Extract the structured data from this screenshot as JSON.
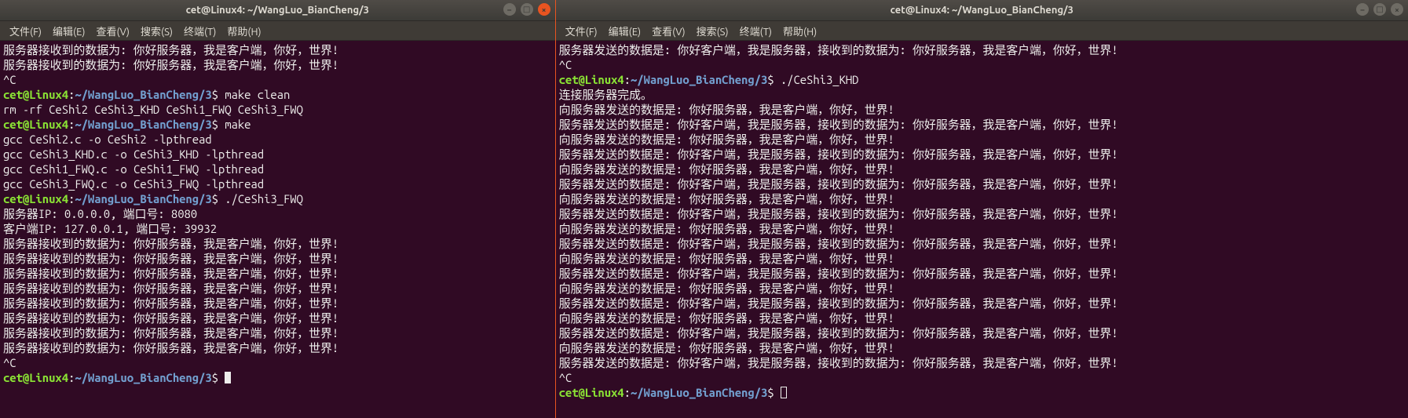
{
  "left": {
    "title": "cet@Linux4: ~/WangLuo_BianCheng/3",
    "menus": [
      "文件(F)",
      "编辑(E)",
      "查看(V)",
      "搜索(S)",
      "终端(T)",
      "帮助(H)"
    ],
    "window_controls": {
      "min": "–",
      "max": "□",
      "close": "×"
    },
    "prompt_user": "cet@Linux4",
    "prompt_colon": ":",
    "prompt_path": "~/WangLuo_BianCheng/3",
    "prompt_dollar": "$",
    "lines": [
      {
        "t": "out",
        "text": "服务器接收到的数据为: 你好服务器，我是客户端，你好，世界!"
      },
      {
        "t": "out",
        "text": "服务器接收到的数据为: 你好服务器，我是客户端，你好，世界!"
      },
      {
        "t": "out",
        "text": "^C"
      },
      {
        "t": "prompt",
        "cmd": "make clean"
      },
      {
        "t": "out",
        "text": "rm -rf CeShi2 CeShi3_KHD CeShi1_FWQ CeShi3_FWQ"
      },
      {
        "t": "prompt",
        "cmd": "make"
      },
      {
        "t": "out",
        "text": "gcc CeShi2.c -o CeShi2 -lpthread"
      },
      {
        "t": "out",
        "text": "gcc CeShi3_KHD.c -o CeShi3_KHD -lpthread"
      },
      {
        "t": "out",
        "text": "gcc CeShi1_FWQ.c -o CeShi1_FWQ -lpthread"
      },
      {
        "t": "out",
        "text": "gcc CeShi3_FWQ.c -o CeShi3_FWQ -lpthread"
      },
      {
        "t": "prompt",
        "cmd": "./CeShi3_FWQ"
      },
      {
        "t": "out",
        "text": "服务器IP: 0.0.0.0, 端口号: 8080"
      },
      {
        "t": "out",
        "text": "客户端IP: 127.0.0.1, 端口号: 39932"
      },
      {
        "t": "out",
        "text": "服务器接收到的数据为: 你好服务器，我是客户端，你好，世界!"
      },
      {
        "t": "out",
        "text": "服务器接收到的数据为: 你好服务器，我是客户端，你好，世界!"
      },
      {
        "t": "out",
        "text": "服务器接收到的数据为: 你好服务器，我是客户端，你好，世界!"
      },
      {
        "t": "out",
        "text": "服务器接收到的数据为: 你好服务器，我是客户端，你好，世界!"
      },
      {
        "t": "out",
        "text": "服务器接收到的数据为: 你好服务器，我是客户端，你好，世界!"
      },
      {
        "t": "out",
        "text": "服务器接收到的数据为: 你好服务器，我是客户端，你好，世界!"
      },
      {
        "t": "out",
        "text": "服务器接收到的数据为: 你好服务器，我是客户端，你好，世界!"
      },
      {
        "t": "out",
        "text": "服务器接收到的数据为: 你好服务器，我是客户端，你好，世界!"
      },
      {
        "t": "out",
        "text": "^C"
      },
      {
        "t": "prompt",
        "cmd": "",
        "cursor": "solid"
      }
    ]
  },
  "right": {
    "title": "cet@Linux4: ~/WangLuo_BianCheng/3",
    "menus": [
      "文件(F)",
      "编辑(E)",
      "查看(V)",
      "搜索(S)",
      "终端(T)",
      "帮助(H)"
    ],
    "window_controls": {
      "min": "–",
      "max": "□",
      "close": "×"
    },
    "prompt_user": "cet@Linux4",
    "prompt_colon": ":",
    "prompt_path": "~/WangLuo_BianCheng/3",
    "prompt_dollar": "$",
    "lines": [
      {
        "t": "out",
        "text": "服务器发送的数据是: 你好客户端，我是服务器，接收到的数据为: 你好服务器，我是客户端，你好，世界!"
      },
      {
        "t": "out",
        "text": "^C"
      },
      {
        "t": "prompt",
        "cmd": "./CeShi3_KHD"
      },
      {
        "t": "out",
        "text": "连接服务器完成。"
      },
      {
        "t": "out",
        "text": "向服务器发送的数据是: 你好服务器，我是客户端，你好，世界!"
      },
      {
        "t": "out",
        "text": "服务器发送的数据是: 你好客户端，我是服务器，接收到的数据为: 你好服务器，我是客户端，你好，世界!"
      },
      {
        "t": "out",
        "text": "向服务器发送的数据是: 你好服务器，我是客户端，你好，世界!"
      },
      {
        "t": "out",
        "text": "服务器发送的数据是: 你好客户端，我是服务器，接收到的数据为: 你好服务器，我是客户端，你好，世界!"
      },
      {
        "t": "out",
        "text": "向服务器发送的数据是: 你好服务器，我是客户端，你好，世界!"
      },
      {
        "t": "out",
        "text": "服务器发送的数据是: 你好客户端，我是服务器，接收到的数据为: 你好服务器，我是客户端，你好，世界!"
      },
      {
        "t": "out",
        "text": "向服务器发送的数据是: 你好服务器，我是客户端，你好，世界!"
      },
      {
        "t": "out",
        "text": "服务器发送的数据是: 你好客户端，我是服务器，接收到的数据为: 你好服务器，我是客户端，你好，世界!"
      },
      {
        "t": "out",
        "text": "向服务器发送的数据是: 你好服务器，我是客户端，你好，世界!"
      },
      {
        "t": "out",
        "text": "服务器发送的数据是: 你好客户端，我是服务器，接收到的数据为: 你好服务器，我是客户端，你好，世界!"
      },
      {
        "t": "out",
        "text": "向服务器发送的数据是: 你好服务器，我是客户端，你好，世界!"
      },
      {
        "t": "out",
        "text": "服务器发送的数据是: 你好客户端，我是服务器，接收到的数据为: 你好服务器，我是客户端，你好，世界!"
      },
      {
        "t": "out",
        "text": "向服务器发送的数据是: 你好服务器，我是客户端，你好，世界!"
      },
      {
        "t": "out",
        "text": "服务器发送的数据是: 你好客户端，我是服务器，接收到的数据为: 你好服务器，我是客户端，你好，世界!"
      },
      {
        "t": "out",
        "text": "向服务器发送的数据是: 你好服务器，我是客户端，你好，世界!"
      },
      {
        "t": "out",
        "text": "服务器发送的数据是: 你好客户端，我是服务器，接收到的数据为: 你好服务器，我是客户端，你好，世界!"
      },
      {
        "t": "out",
        "text": "向服务器发送的数据是: 你好服务器，我是客户端，你好，世界!"
      },
      {
        "t": "out",
        "text": "服务器发送的数据是: 你好客户端，我是服务器，接收到的数据为: 你好服务器，我是客户端，你好，世界!"
      },
      {
        "t": "out",
        "text": "^C"
      },
      {
        "t": "prompt",
        "cmd": "",
        "cursor": "hollow"
      }
    ]
  }
}
